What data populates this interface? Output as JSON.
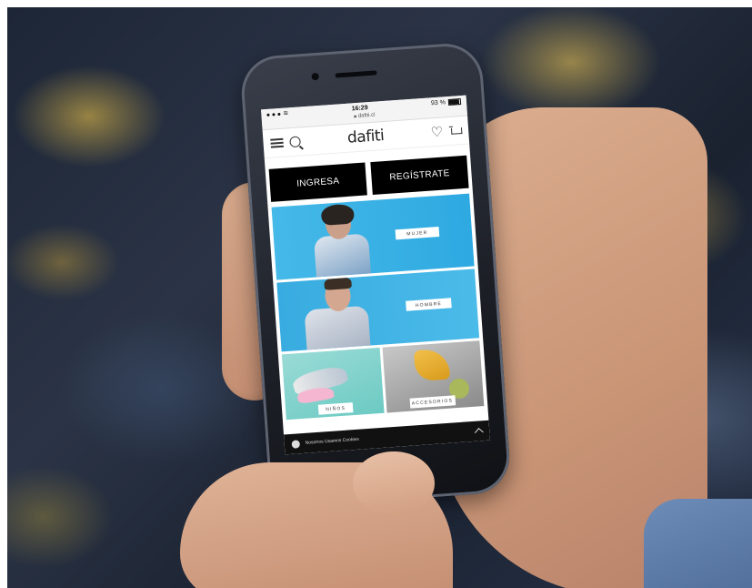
{
  "status_bar": {
    "time": "16:29",
    "battery_label": "93 %"
  },
  "browser": {
    "url": "dafiti.cl"
  },
  "app_bar": {
    "logo": "dafiti"
  },
  "auth": {
    "login_label": "INGRESA",
    "register_label": "REGÍSTRATE"
  },
  "banners": {
    "mujer_label": "MUJER",
    "hombre_label": "HOMBRE",
    "ninos_label": "NIÑOS",
    "accesorios_label": "ACCESORIOS"
  },
  "cookie_bar": {
    "text": "Nosotros Usamos Cookies"
  },
  "colors": {
    "banner_blue": "#35ade3",
    "button_black": "#000000",
    "kids_teal": "#7fd2cc"
  },
  "icons": [
    "menu-icon",
    "search-icon",
    "heart-icon",
    "cart-icon",
    "chevron-up-icon",
    "cookie-icon"
  ]
}
